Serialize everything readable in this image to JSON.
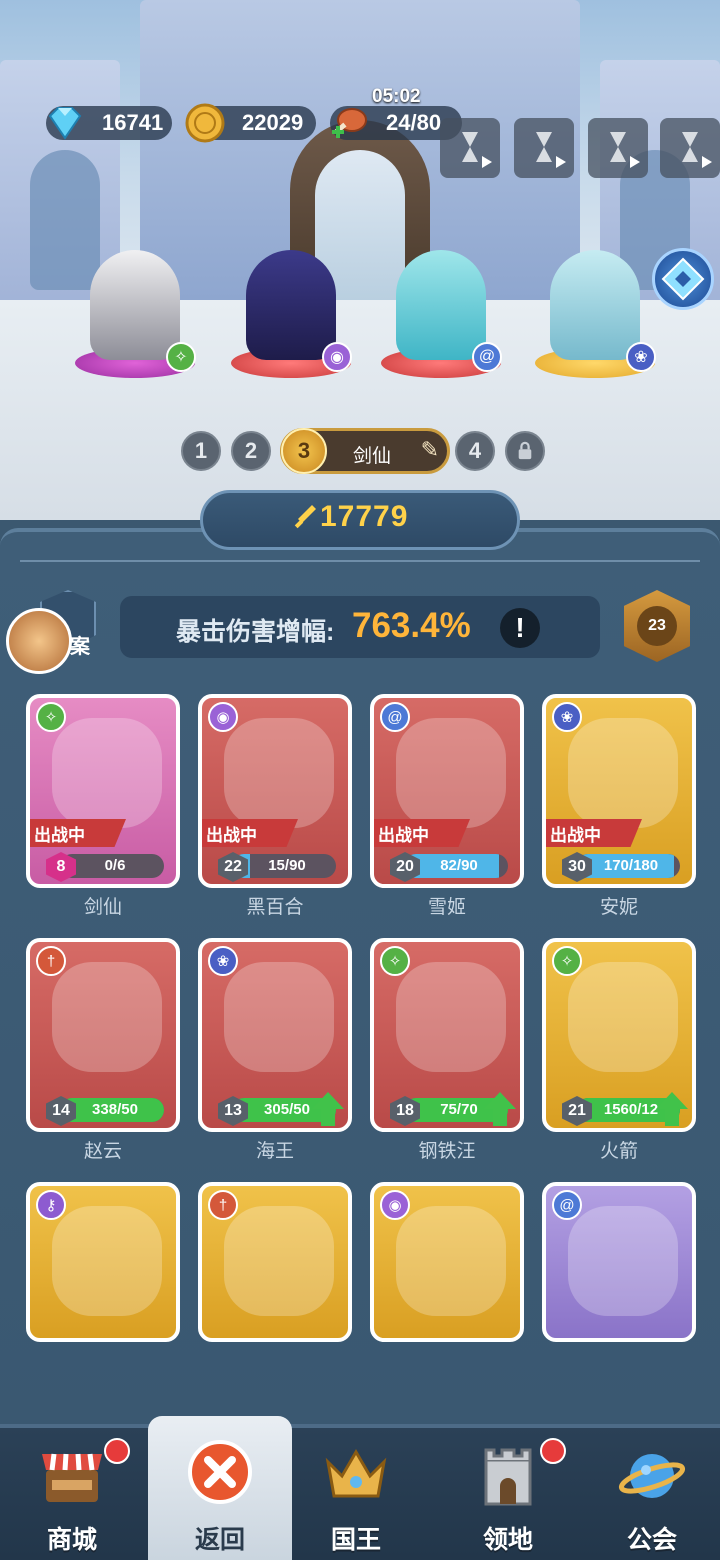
{
  "resources": {
    "gems": "16741",
    "coins": "22029",
    "stamina": "24/80",
    "stamina_timer": "05:02"
  },
  "team_tabs": {
    "tabs": [
      "1",
      "2",
      "3",
      "4"
    ],
    "active_index": "3",
    "active_name": "剑仙"
  },
  "power": "17779",
  "crit": {
    "label": "暴击伤害增幅:",
    "value": "763.4%",
    "info": "!"
  },
  "rank_level": "23",
  "archive_label": "案",
  "deploy_label": "出战中",
  "heroes": [
    {
      "name": "剑仙",
      "level": "8",
      "progress": "0/6",
      "progress_fraction": 0.0,
      "deployed": true,
      "rarity": "pink",
      "class_icon": "constellation-icon",
      "upgrade": false
    },
    {
      "name": "黑百合",
      "level": "22",
      "progress": "15/90",
      "progress_fraction": 0.17,
      "deployed": true,
      "rarity": "red",
      "class_icon": "eye-icon",
      "upgrade": false
    },
    {
      "name": "雪姬",
      "level": "20",
      "progress": "82/90",
      "progress_fraction": 0.91,
      "deployed": true,
      "rarity": "red",
      "class_icon": "swirl-icon",
      "upgrade": false
    },
    {
      "name": "安妮",
      "level": "30",
      "progress": "170/180",
      "progress_fraction": 0.94,
      "deployed": true,
      "rarity": "gold",
      "class_icon": "paw-icon",
      "upgrade": false
    },
    {
      "name": "赵云",
      "level": "14",
      "progress": "338/50",
      "progress_fraction": 1.0,
      "deployed": false,
      "rarity": "red",
      "class_icon": "sword-icon",
      "upgrade": false
    },
    {
      "name": "海王",
      "level": "13",
      "progress": "305/50",
      "progress_fraction": 1.0,
      "deployed": false,
      "rarity": "red",
      "class_icon": "paw-icon",
      "upgrade": true
    },
    {
      "name": "钢铁汪",
      "level": "18",
      "progress": "75/70",
      "progress_fraction": 1.0,
      "deployed": false,
      "rarity": "red",
      "class_icon": "constellation-icon",
      "upgrade": true
    },
    {
      "name": "火箭",
      "level": "21",
      "progress": "1560/12",
      "progress_fraction": 1.0,
      "deployed": false,
      "rarity": "gold",
      "class_icon": "constellation-icon",
      "upgrade": true
    },
    {
      "name": "",
      "level": "",
      "progress": "",
      "progress_fraction": 0.0,
      "deployed": false,
      "rarity": "gold",
      "class_icon": "key-icon",
      "upgrade": false
    },
    {
      "name": "",
      "level": "",
      "progress": "",
      "progress_fraction": 0.0,
      "deployed": false,
      "rarity": "gold",
      "class_icon": "sword-icon",
      "upgrade": false
    },
    {
      "name": "",
      "level": "",
      "progress": "",
      "progress_fraction": 0.0,
      "deployed": false,
      "rarity": "gold",
      "class_icon": "eye-icon",
      "upgrade": false
    },
    {
      "name": "",
      "level": "",
      "progress": "",
      "progress_fraction": 0.0,
      "deployed": false,
      "rarity": "purple",
      "class_icon": "swirl-icon",
      "upgrade": false
    }
  ],
  "nav": {
    "shop": "商城",
    "back": "返回",
    "king": "国王",
    "territory": "领地",
    "guild": "公会"
  },
  "colors": {
    "accent_gold": "#ffb53a",
    "power_yellow": "#ffd24a",
    "deploy_red": "#c83a3a",
    "progress_blue": "#4fb6e8",
    "progress_green": "#3fc24a"
  }
}
